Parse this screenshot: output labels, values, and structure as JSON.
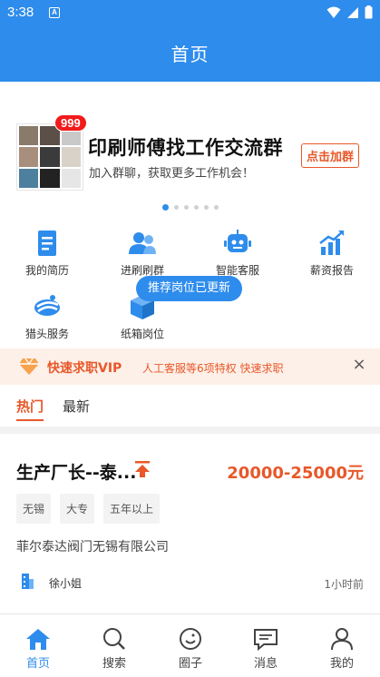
{
  "status_bar": {
    "time": "3:38",
    "notification_glyph": "A",
    "icons": [
      "wifi-icon",
      "signal-icon",
      "battery-icon"
    ]
  },
  "app_bar": {
    "title": "首页"
  },
  "banner": {
    "badge_count": "999",
    "title": "印刷师傅找工作交流群",
    "subtitle": "加入群聊，获取更多工作机会！",
    "join_button": "点击加群",
    "pages": 6,
    "active_page": 1
  },
  "menu": {
    "items": [
      {
        "label": "我的简历",
        "icon": "resume-icon"
      },
      {
        "label": "进刷刷群",
        "icon": "users-icon"
      },
      {
        "label": "智能客服",
        "icon": "robot-icon"
      },
      {
        "label": "薪资报告",
        "icon": "bar-chart-icon"
      },
      {
        "label": "猎头服务",
        "icon": "headhunter-icon"
      },
      {
        "label": "纸箱岗位",
        "icon": "box-icon"
      }
    ],
    "tooltip": "推荐岗位已更新"
  },
  "vip_bar": {
    "title": "快速求职VIP",
    "description": "人工客服等6项特权 快速求职",
    "close": "×"
  },
  "tabs": [
    {
      "label": "热门",
      "active": true
    },
    {
      "label": "最新",
      "active": false
    }
  ],
  "job": {
    "title": "生产厂长--泰...",
    "salary": "20000-25000元",
    "tags": [
      "无锡",
      "大专",
      "五年以上"
    ],
    "company": "菲尔泰达阀门无锡有限公司",
    "recruiter": "徐小姐",
    "posted": "1小时前"
  },
  "bottom_nav": {
    "items": [
      {
        "label": "首页",
        "icon": "home-icon",
        "active": true
      },
      {
        "label": "搜索",
        "icon": "search-icon",
        "active": false
      },
      {
        "label": "圈子",
        "icon": "circle-icon",
        "active": false
      },
      {
        "label": "消息",
        "icon": "message-icon",
        "active": false
      },
      {
        "label": "我的",
        "icon": "profile-icon",
        "active": false
      }
    ]
  },
  "colors": {
    "primary": "#2e8cec",
    "accent": "#e8582a",
    "badge": "#f21a1a",
    "vip_background": "#fdf0e8"
  }
}
